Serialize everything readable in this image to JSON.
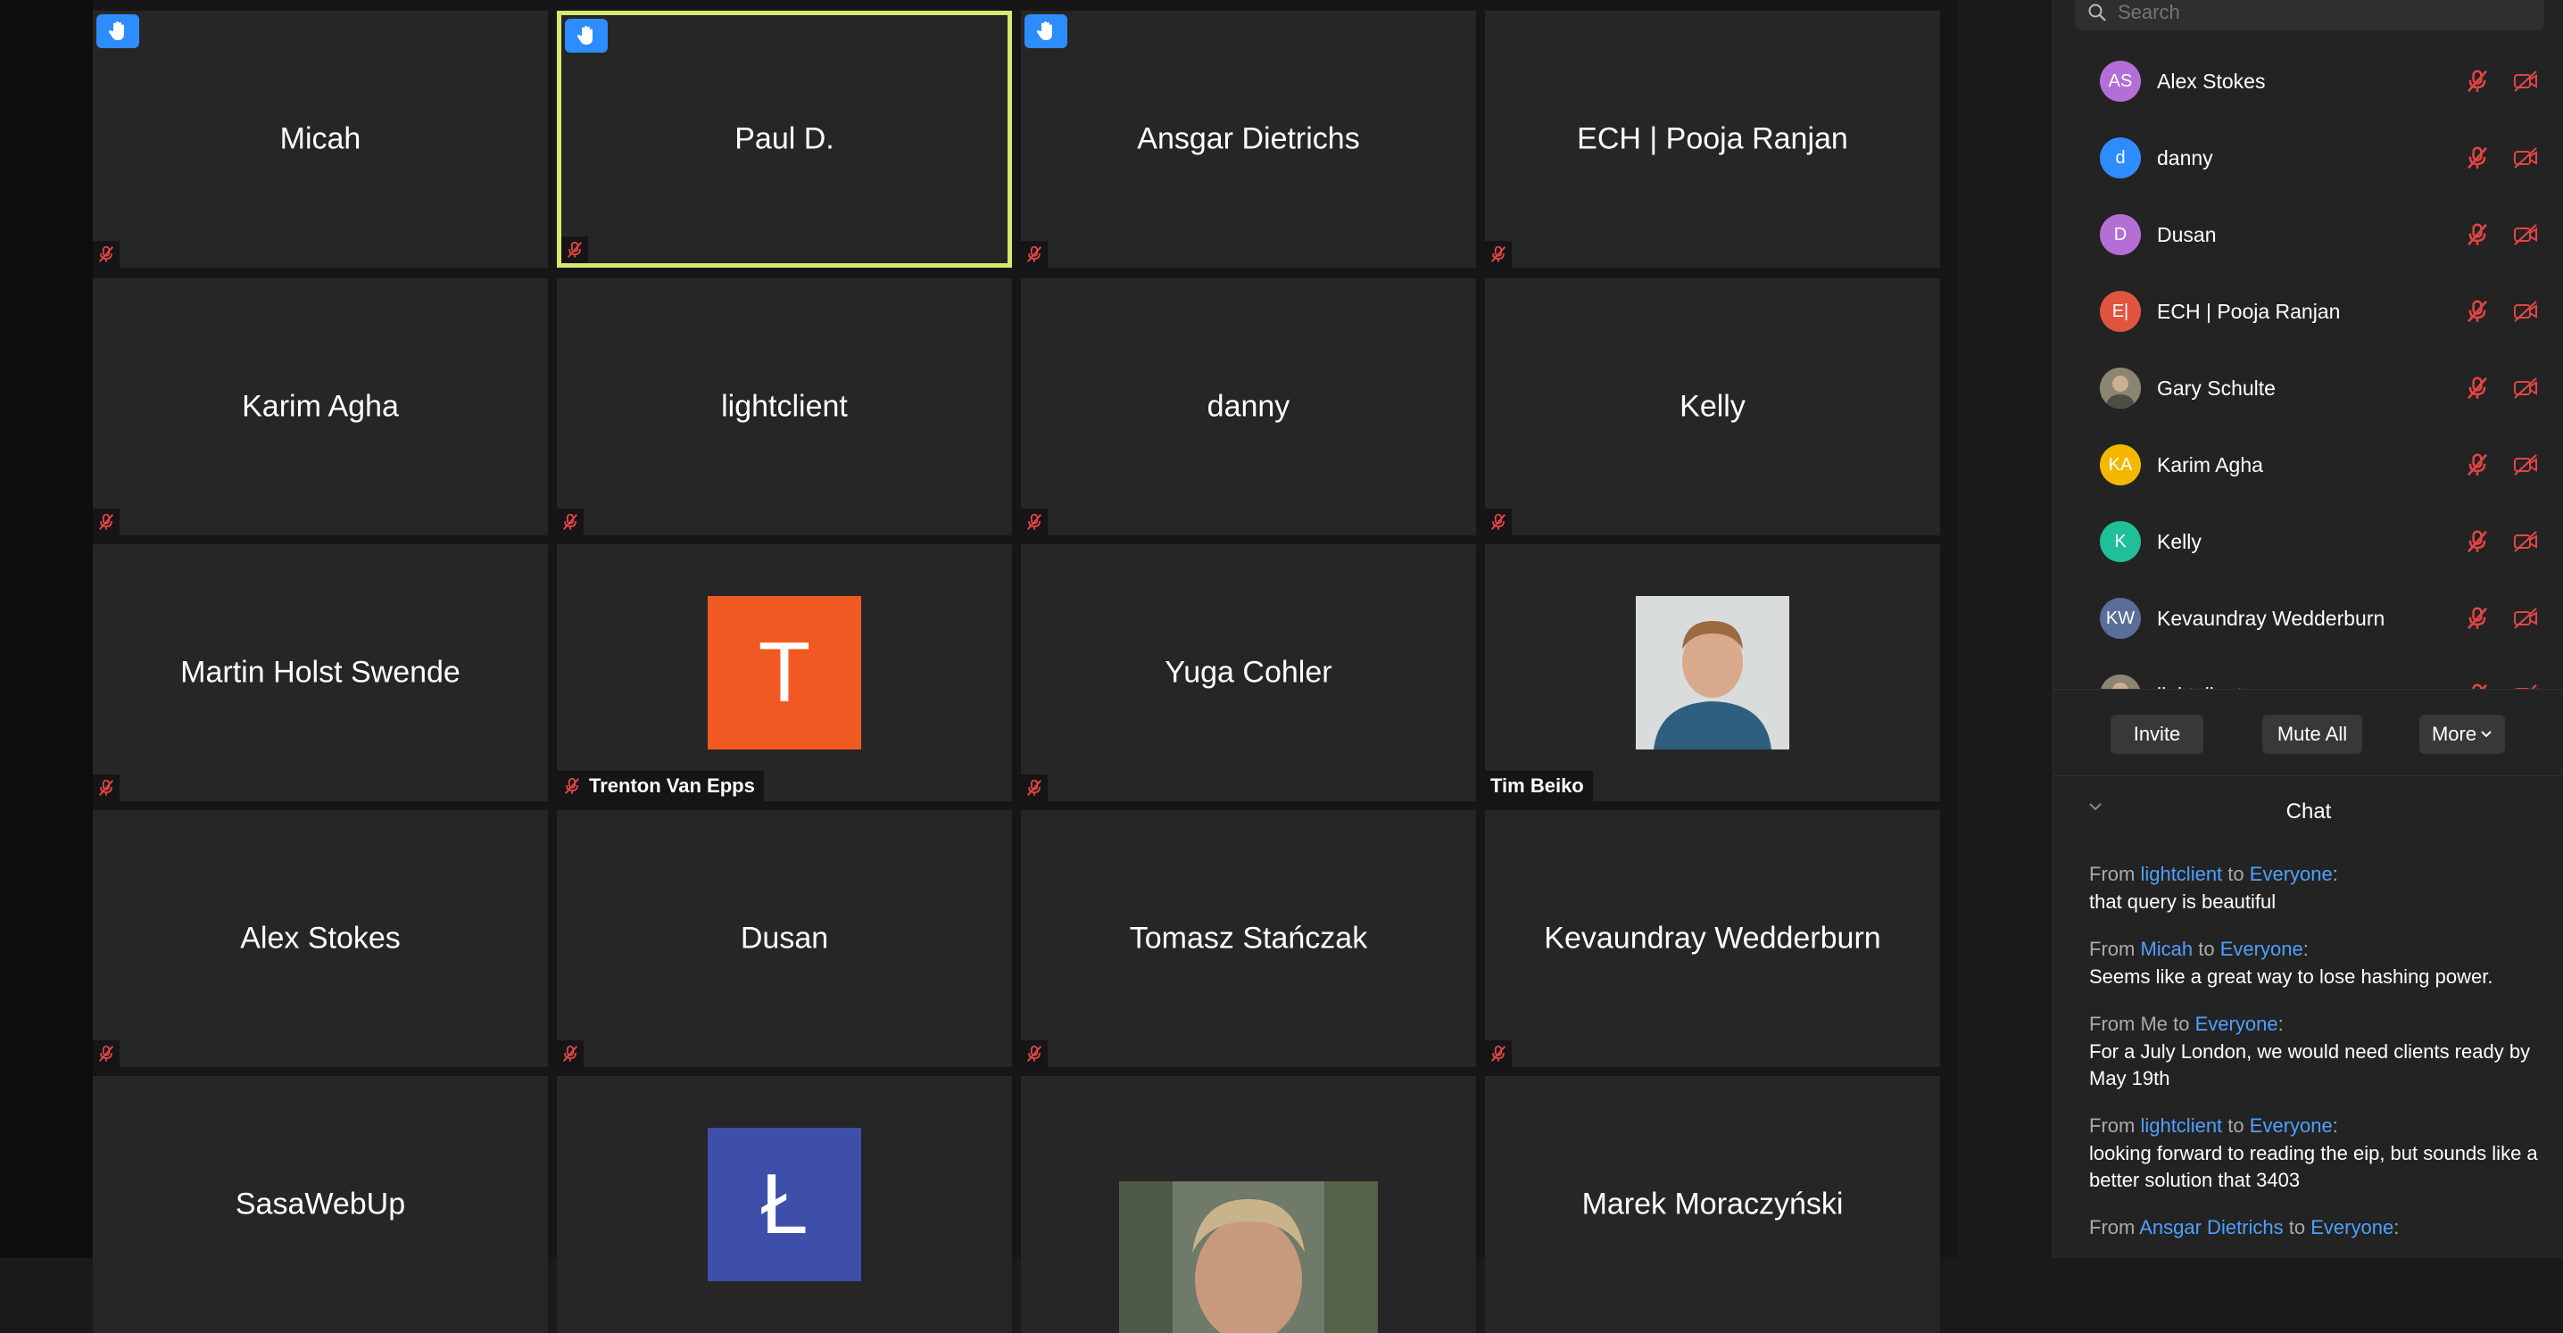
{
  "tiles": [
    {
      "name": "Micah",
      "hand": true
    },
    {
      "name": "Paul D.",
      "hand": true,
      "active": true
    },
    {
      "name": "Ansgar Dietrichs",
      "hand": true
    },
    {
      "name": "ECH | Pooja Ranjan"
    },
    {
      "name": "Karim Agha"
    },
    {
      "name": "lightclient"
    },
    {
      "name": "danny"
    },
    {
      "name": "Kelly"
    },
    {
      "name": "Martin Holst Swende"
    },
    {
      "name": "Trenton Van Epps",
      "avatar_letter": "T",
      "avatar_color": "#f05a22"
    },
    {
      "name": "Yuga Cohler"
    },
    {
      "name": "Tim Beiko",
      "photo": true
    },
    {
      "name": "Alex Stokes"
    },
    {
      "name": "Dusan"
    },
    {
      "name": "Tomasz Stańczak"
    },
    {
      "name": "Kevaundray Wedderburn"
    },
    {
      "name": "SasaWebUp"
    },
    {
      "name": "",
      "avatar_letter": "Ł",
      "avatar_color": "#3d4fa8"
    },
    {
      "name": "",
      "photo": true
    },
    {
      "name": "Marek Moraczyński"
    }
  ],
  "search": {
    "placeholder": "Search"
  },
  "participants": [
    {
      "initials": "AS",
      "name": "Alex Stokes",
      "color": "#b46fd6"
    },
    {
      "initials": "d",
      "name": "danny",
      "color": "#2d8cff"
    },
    {
      "initials": "D",
      "name": "Dusan",
      "color": "#b46fd6"
    },
    {
      "initials": "E|",
      "name": "ECH | Pooja Ranjan",
      "color": "#e0553f"
    },
    {
      "initials": "",
      "name": "Gary Schulte",
      "color": "#7a7a6a"
    },
    {
      "initials": "KA",
      "name": "Karim Agha",
      "color": "#f5b800"
    },
    {
      "initials": "K",
      "name": "Kelly",
      "color": "#1fbf9a"
    },
    {
      "initials": "KW",
      "name": "Kevaundray Wedderburn",
      "color": "#5a6e9a"
    },
    {
      "initials": "",
      "name": "lightclient",
      "color": "#e0553f"
    }
  ],
  "buttons": {
    "invite": "Invite",
    "mute_all": "Mute All",
    "more": "More"
  },
  "chat": {
    "title": "Chat",
    "from_word": "From",
    "to_word": "to",
    "messages": [
      {
        "from": "lightclient",
        "to": "Everyone",
        "text": "that query is beautiful"
      },
      {
        "from": "Micah",
        "to": "Everyone",
        "text": "Seems like a great way to lose hashing power."
      },
      {
        "from": "Me",
        "to": "Everyone",
        "text": "For a July London, we would need clients ready by May 19th"
      },
      {
        "from": "lightclient",
        "to": "Everyone",
        "text": "looking forward to reading the eip, but sounds like a better solution that 3403"
      },
      {
        "from": "Ansgar Dietrichs",
        "to": "Everyone",
        "text": ""
      }
    ]
  },
  "colors": {
    "accent": "#2d8cff",
    "active_speaker": "#d6e86f",
    "muted": "#e04545"
  }
}
